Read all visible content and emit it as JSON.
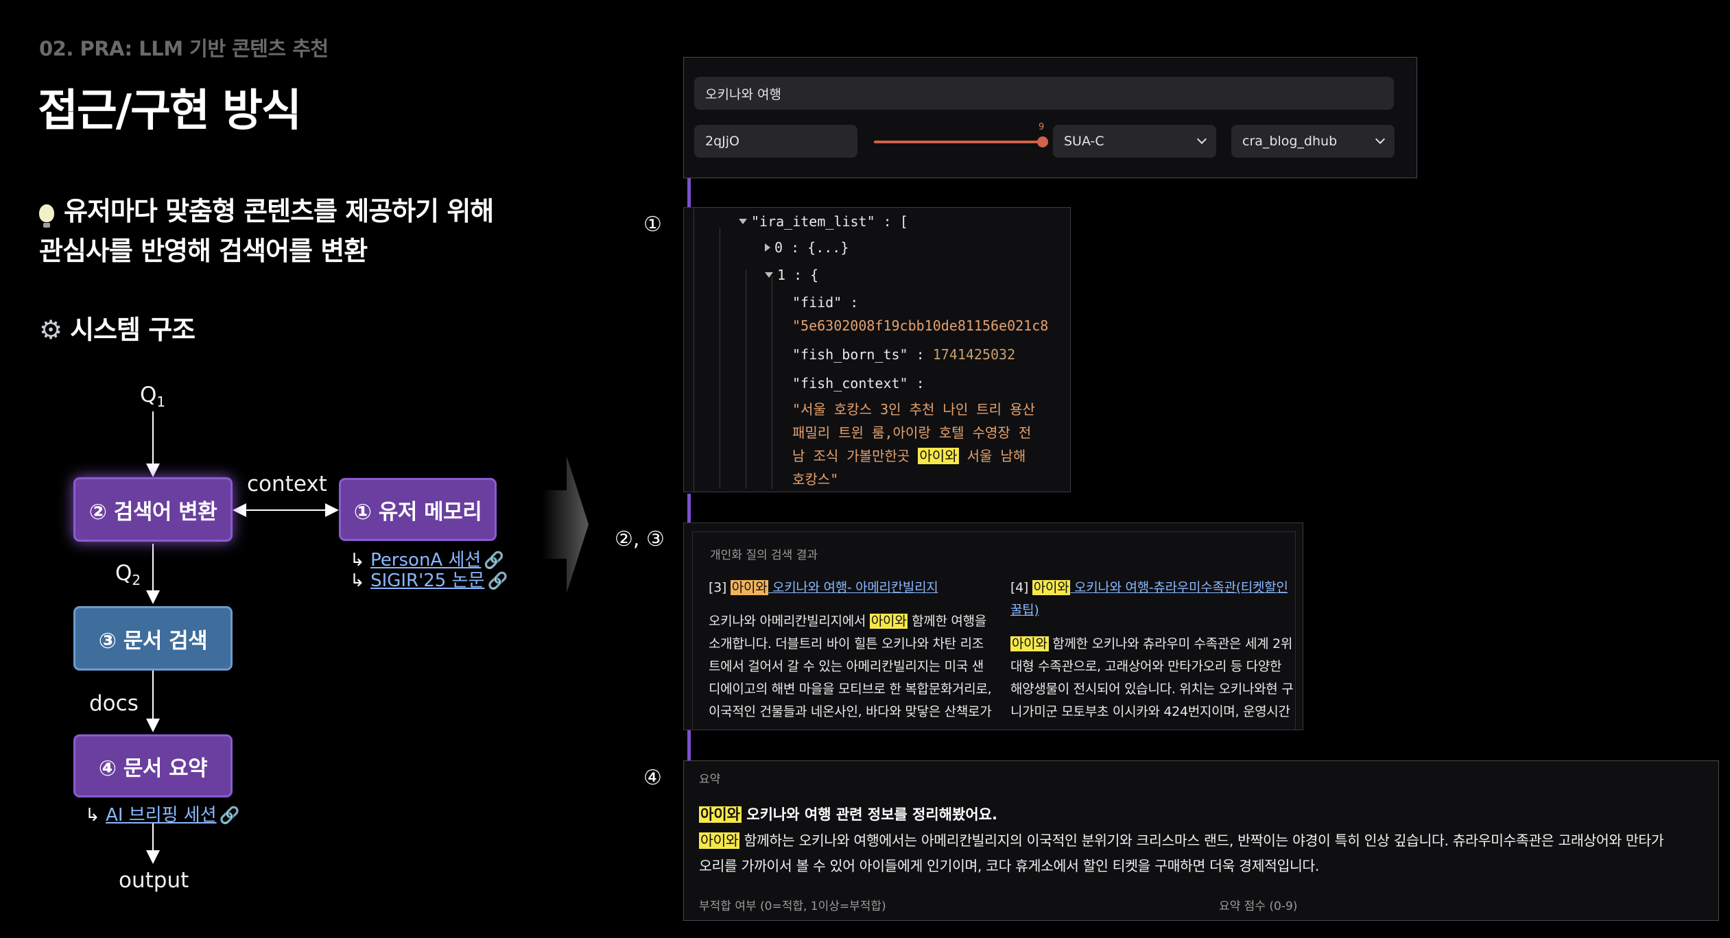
{
  "slide": {
    "section": "02. PRA: LLM 기반 콘텐츠 추천",
    "title": "접근/구현 방식",
    "bullet1_line1": "유저마다 맞춤형 콘텐츠를 제공하기 위해",
    "bullet1_line2": "관심사를 반영해 검색어를 변환",
    "bullet2": "시스템 구조"
  },
  "diagram": {
    "q1": "Q",
    "q1_sub": "1",
    "q2": "Q",
    "q2_sub": "2",
    "context": "context",
    "docs": "docs",
    "output": "output",
    "node_query": "② 검색어 변환",
    "node_memory": "① 유저 메모리",
    "node_search": "③ 문서 검색",
    "node_summary": "④ 문서 요약",
    "links": {
      "persona": "PersonA 세션",
      "sigir": "SIGIR'25 논문",
      "briefing": "AI 브리핑 세션"
    }
  },
  "markers": {
    "m1": "①",
    "m23": "②, ③",
    "m4": "④"
  },
  "ui": {
    "query_input": "오키나와 여행",
    "user_id": "2qJjO",
    "slider_value": "9",
    "slider_fraction": 1.0,
    "model_select": "SUA-C",
    "db_select": "cra_blog_dhub",
    "json": {
      "list_key": "\"ira_item_list\"",
      "item0_index": "0",
      "item0_collapsed": "{...}",
      "item1_index": "1",
      "fiid_key": "\"fiid\"",
      "fiid_value": "\"5e6302008f19cbb10de81156e021c8",
      "born_key": "\"fish_born_ts\"",
      "born_value": "1741425032",
      "context_key": "\"fish_context\"",
      "context_l1": "\"서울 호캉스 3인 추천 나인 트리 용산",
      "context_l2": "패밀리 트윈 룸,아이랑 호텔 수영장 전",
      "context_l3a": "남 조식 가볼만한곳 ",
      "context_l3hl": "아이와",
      "context_l3b": " 서울 남해",
      "context_l4": "호캉스\""
    },
    "results": {
      "label": "개인화 질의 검색 결과",
      "col1": {
        "num": "[3]",
        "hl": "아이와",
        "link": " 오키나와 여행- 아메리칸빌리지",
        "l1a": "오키나와 아메리칸빌리지에서 ",
        "l1hl": "아이와",
        "l1b": " 함께한 여행을",
        "l2": "소개합니다. 더블트리 바이 힐튼 오키나와 차탄 리조",
        "l3": "트에서 걸어서 갈 수 있는 아메리칸빌리지는 미국 샌",
        "l4": "디에이고의 해변 마을을 모티브로 한 복합문화거리로,",
        "l5": "이국적인 건물들과 네온사인, 바다와 맞닿은 산책로가"
      },
      "col2": {
        "num": "[4]",
        "hl": "아이와",
        "link1": " 오키나와 여행-츄라우미수족관(티켓할인",
        "link2": "꿀팁)",
        "l1hl": "아이와",
        "l1b": " 함께한 오키나와 츄라우미 수족관은 세계 2위",
        "l2": "대형 수족관으로, 고래상어와 만타가오리 등 다양한",
        "l3": "해양생물이 전시되어 있습니다. 위치는 오키나와현 구",
        "l4": "니가미군 모토부초 이시카와 424번지이며, 운영시간"
      }
    },
    "summary": {
      "label": "요약",
      "headline_hl": "아이와",
      "headline": " 오키나와 여행 관련 정보를 정리해봤어요.",
      "body_hl": "아이와",
      "body1": " 함께하는 오키나와 여행에서는 아메리칸빌리지의 이국적인 분위기와 크리스마스 랜드, 반짝이는 야경이 특히 인상 깊습니다. 츄라우미수족관은 고래상어와 만타가",
      "body2": "오리를 가까이서 볼 수 있어 아이들에게 인기이며, 코다 휴게소에서 할인 티켓을 구매하면 더욱 경제적입니다.",
      "footer_left": "부적합 여부 (0=적합, 1이상=부적합)",
      "footer_right": "요약 점수 (0-9)"
    }
  },
  "colors": {
    "purple_node": "#6b3fa0",
    "blue_node": "#3f6d9c",
    "accent_bar": "#7b4fd0",
    "slider_fill": "#d0634a",
    "highlight": "#f6e84b"
  }
}
